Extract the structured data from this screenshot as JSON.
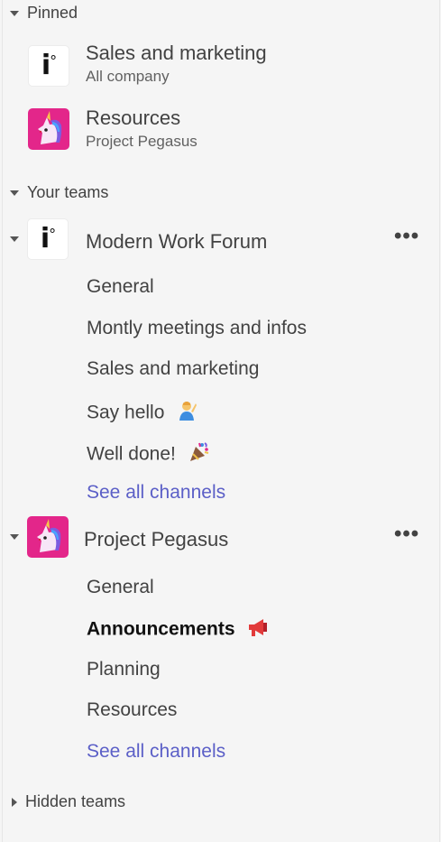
{
  "sections": {
    "pinned": {
      "label": "Pinned"
    },
    "your_teams": {
      "label": "Your teams"
    },
    "hidden_teams": {
      "label": "Hidden teams"
    }
  },
  "pinned": [
    {
      "name": "Sales and marketing",
      "subtitle": "All company",
      "avatar": "io-logo"
    },
    {
      "name": "Resources",
      "subtitle": "Project Pegasus",
      "avatar": "unicorn-icon"
    }
  ],
  "teams": [
    {
      "name": "Modern Work Forum",
      "avatar": "io-logo",
      "more": "•••",
      "channels": [
        {
          "label": "General"
        },
        {
          "label": "Montly meetings and infos"
        },
        {
          "label": "Sales and marketing"
        },
        {
          "label": "Say hello",
          "icon": "person-waving-icon"
        },
        {
          "label": "Well done!",
          "icon": "party-popper-icon"
        }
      ],
      "see_all": "See all channels"
    },
    {
      "name": "Project Pegasus",
      "avatar": "unicorn-icon",
      "more": "•••",
      "channels": [
        {
          "label": "General"
        },
        {
          "label": "Announcements",
          "bold": true,
          "icon": "megaphone-icon"
        },
        {
          "label": "Planning"
        },
        {
          "label": "Resources"
        }
      ],
      "see_all": "See all channels"
    }
  ],
  "logo": {
    "text": "i",
    "mark": "°"
  },
  "colors": {
    "link": "#5b5fc7",
    "unicorn_bg": "#e3268a",
    "text": "#424242"
  }
}
